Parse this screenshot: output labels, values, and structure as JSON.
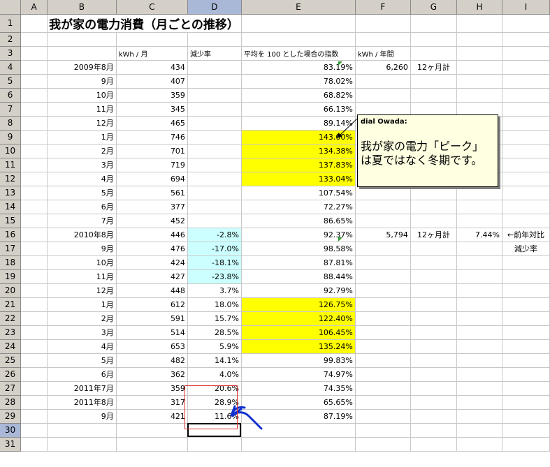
{
  "columns": [
    "A",
    "B",
    "C",
    "D",
    "E",
    "F",
    "G",
    "H",
    "I"
  ],
  "selected_column": "D",
  "selected_row": 30,
  "title": "我が家の電力消費（月ごとの推移）",
  "headers": {
    "c": "kWh / 月",
    "d": "減少率",
    "e": "平均を 100 とした場合の指数",
    "f": "kWh / 年間"
  },
  "rows": [
    {
      "n": 4,
      "b": "2009年8月",
      "c": "434",
      "d": "",
      "e": "83.19%",
      "f": "6,260",
      "g": "12ヶ月計",
      "h": "",
      "i": ""
    },
    {
      "n": 5,
      "b": "9月",
      "c": "407",
      "d": "",
      "e": "78.02%"
    },
    {
      "n": 6,
      "b": "10月",
      "c": "359",
      "d": "",
      "e": "68.82%"
    },
    {
      "n": 7,
      "b": "11月",
      "c": "345",
      "d": "",
      "e": "66.13%"
    },
    {
      "n": 8,
      "b": "12月",
      "c": "465",
      "d": "",
      "e": "89.14%"
    },
    {
      "n": 9,
      "b": "1月",
      "c": "746",
      "d": "",
      "e": "143.00%",
      "ey": true
    },
    {
      "n": 10,
      "b": "2月",
      "c": "701",
      "d": "",
      "e": "134.38%",
      "ey": true
    },
    {
      "n": 11,
      "b": "3月",
      "c": "719",
      "d": "",
      "e": "137.83%",
      "ey": true
    },
    {
      "n": 12,
      "b": "4月",
      "c": "694",
      "d": "",
      "e": "133.04%",
      "ey": true
    },
    {
      "n": 13,
      "b": "5月",
      "c": "561",
      "d": "",
      "e": "107.54%"
    },
    {
      "n": 14,
      "b": "6月",
      "c": "377",
      "d": "",
      "e": "72.27%"
    },
    {
      "n": 15,
      "b": "7月",
      "c": "452",
      "d": "",
      "e": "86.65%"
    },
    {
      "n": 16,
      "b": "2010年8月",
      "c": "446",
      "d": "-2.8%",
      "e": "92.37%",
      "dc": true,
      "f": "5,794",
      "g": "12ヶ月計",
      "h": "7.44%",
      "i": "←前年対比"
    },
    {
      "n": 17,
      "b": "9月",
      "c": "476",
      "d": "-17.0%",
      "e": "98.58%",
      "dc": true,
      "i": "減少率"
    },
    {
      "n": 18,
      "b": "10月",
      "c": "424",
      "d": "-18.1%",
      "e": "87.81%",
      "dc": true
    },
    {
      "n": 19,
      "b": "11月",
      "c": "427",
      "d": "-23.8%",
      "e": "88.44%",
      "dc": true
    },
    {
      "n": 20,
      "b": "12月",
      "c": "448",
      "d": "3.7%",
      "e": "92.79%"
    },
    {
      "n": 21,
      "b": "1月",
      "c": "612",
      "d": "18.0%",
      "e": "126.75%",
      "ey": true
    },
    {
      "n": 22,
      "b": "2月",
      "c": "591",
      "d": "15.7%",
      "e": "122.40%",
      "ey": true
    },
    {
      "n": 23,
      "b": "3月",
      "c": "514",
      "d": "28.5%",
      "e": "106.45%",
      "ey": true
    },
    {
      "n": 24,
      "b": "4月",
      "c": "653",
      "d": "5.9%",
      "e": "135.24%",
      "ey": true
    },
    {
      "n": 25,
      "b": "5月",
      "c": "482",
      "d": "14.1%",
      "e": "99.83%"
    },
    {
      "n": 26,
      "b": "6月",
      "c": "362",
      "d": "4.0%",
      "e": "74.97%"
    },
    {
      "n": 27,
      "b": "2011年7月",
      "c": "359",
      "d": "20.6%",
      "e": "74.35%"
    },
    {
      "n": 28,
      "b": "2011年8月",
      "c": "317",
      "d": "28.9%",
      "e": "65.65%"
    },
    {
      "n": 29,
      "b": "9月",
      "c": "421",
      "d": "11.6%",
      "e": "87.19%"
    }
  ],
  "comment": {
    "author": "dial Owada:",
    "line1": "我が家の電力「ピーク」",
    "line2": "は夏ではなく冬期です。"
  },
  "colors": {
    "highlight_yellow": "#ffff00",
    "highlight_cyan": "#ccffff",
    "annotation_red": "#e03030",
    "annotation_blue": "#1030d0"
  }
}
